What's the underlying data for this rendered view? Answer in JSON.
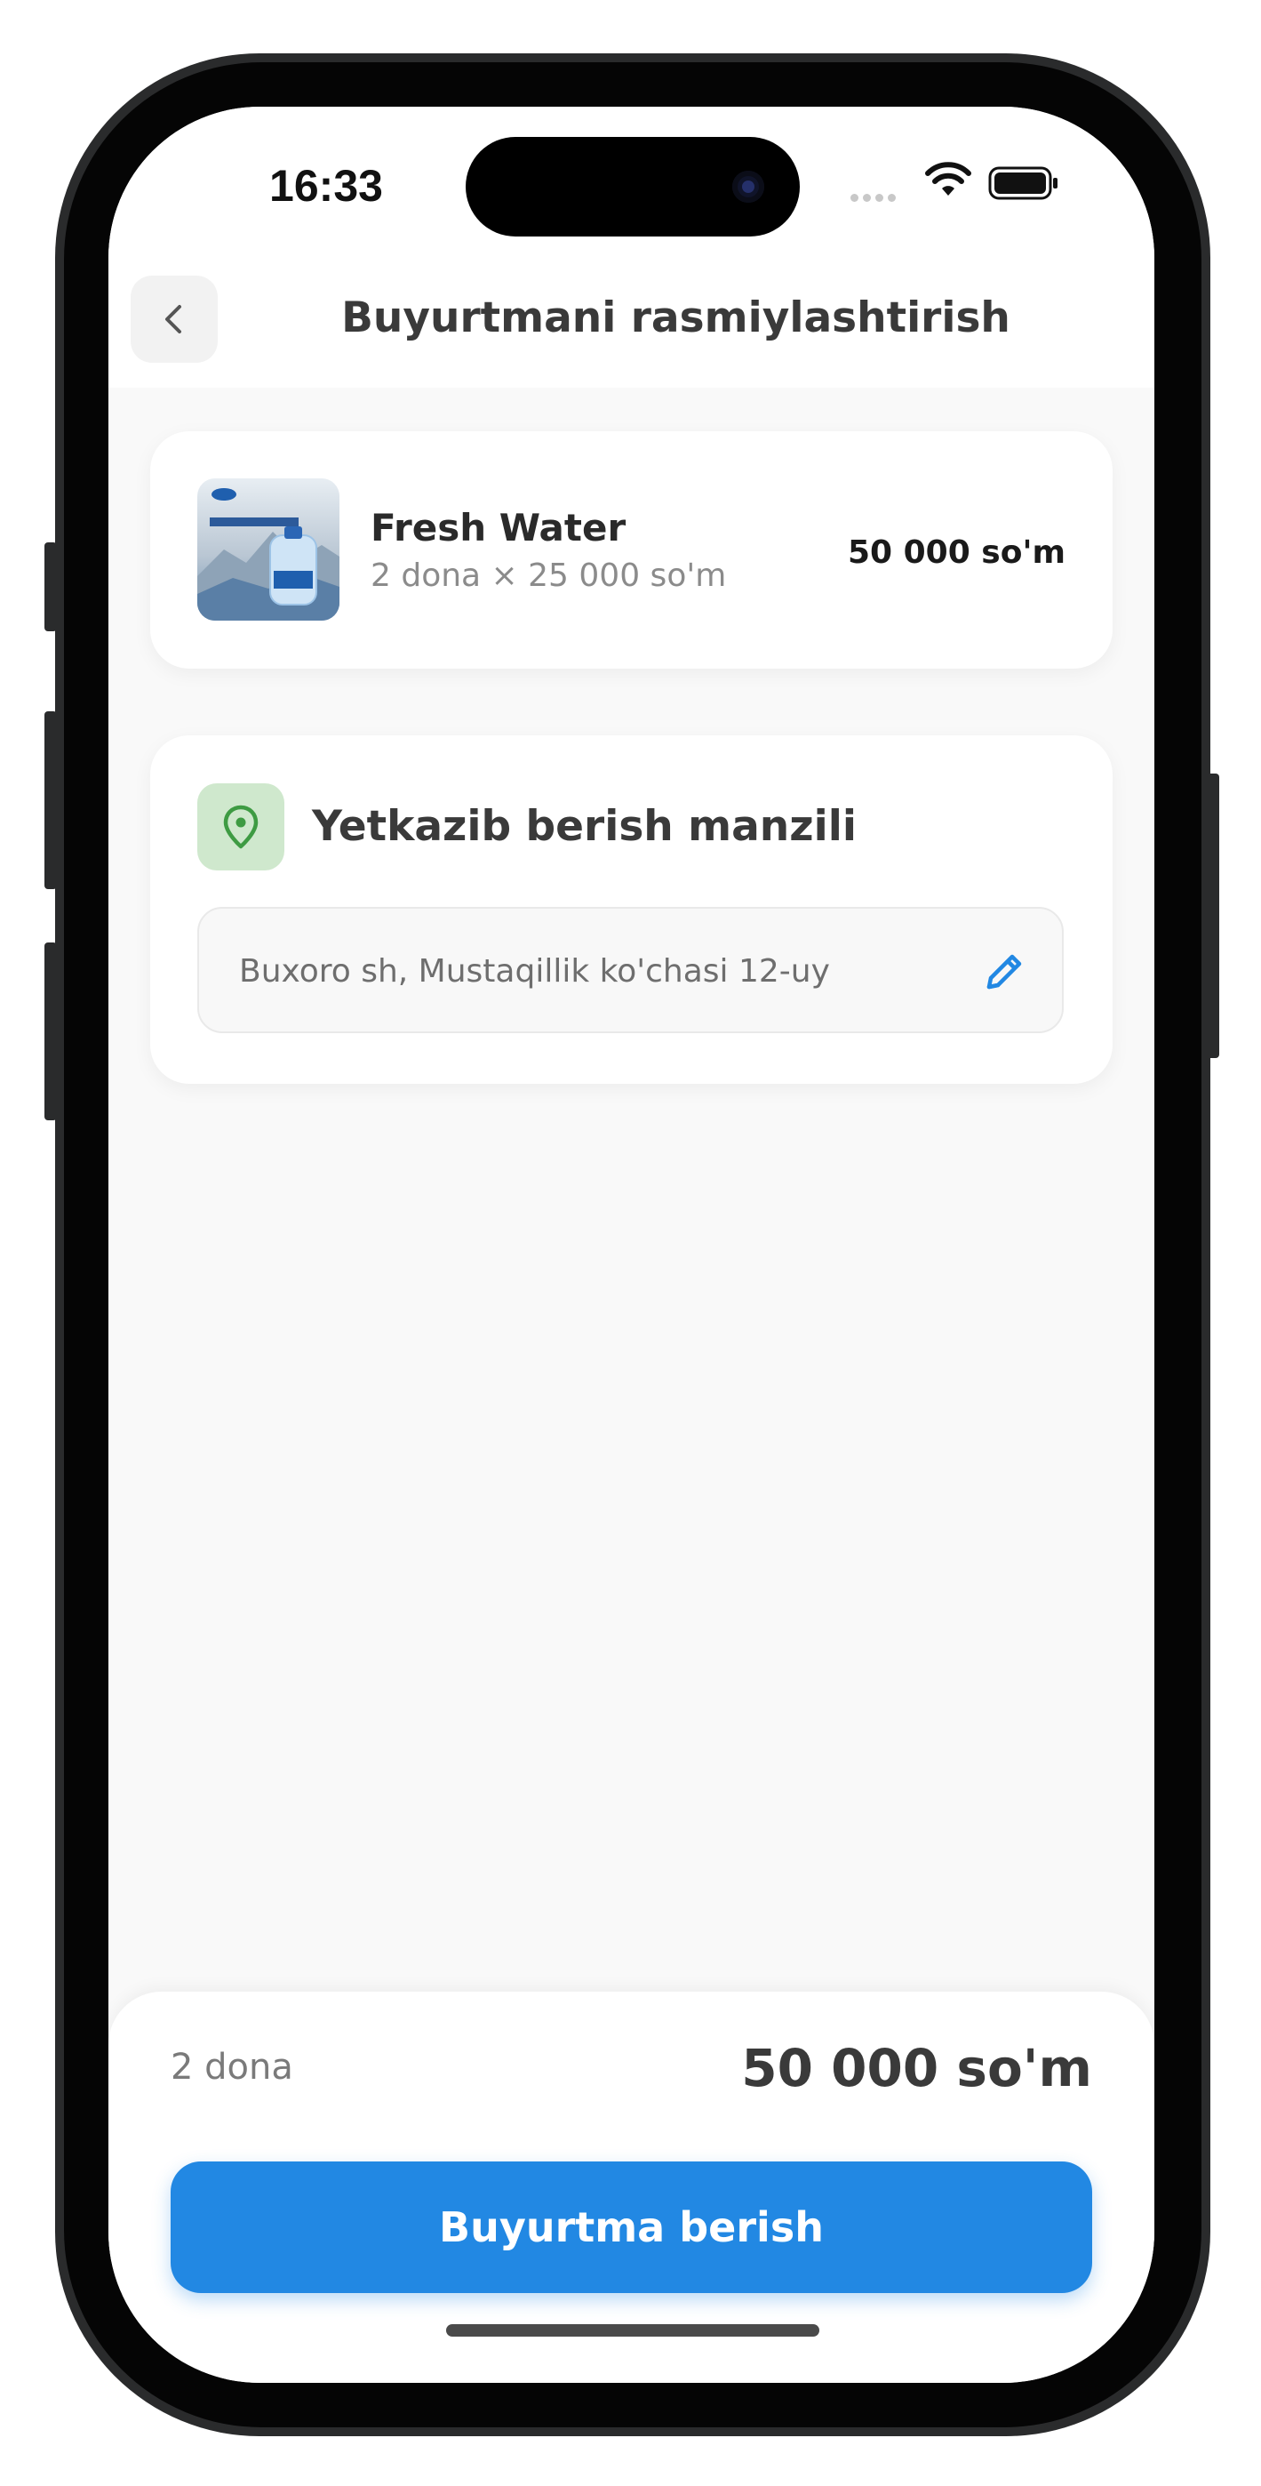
{
  "status_bar": {
    "time": "16:33"
  },
  "header": {
    "title": "Buyurtmani rasmiylashtirish"
  },
  "order_item": {
    "name": "Fresh Water",
    "quantity_line": "2 dona × 25 000 so'm",
    "total": "50 000 so'm",
    "image_icon": "water-bottle-product-image"
  },
  "delivery": {
    "heading": "Yetkazib berish manzili",
    "address": "Buxoro sh, Mustaqillik ko'chasi 12-uy",
    "icon": "location-pin-icon"
  },
  "summary": {
    "quantity": "2 dona",
    "total": "50 000 so'm",
    "button_label": "Buyurtma berish"
  },
  "colors": {
    "accent": "#2288e3",
    "pin_green": "#3e9b43",
    "pin_bg": "#cfe8cd"
  }
}
